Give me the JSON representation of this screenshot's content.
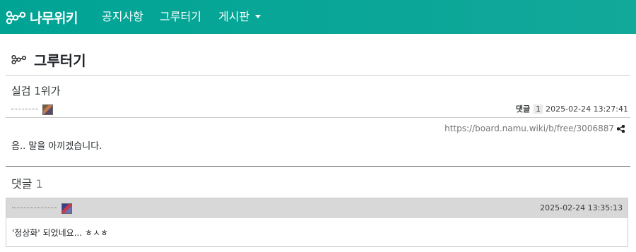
{
  "navbar": {
    "brand": "나무위키",
    "items": [
      {
        "label": "공지사항"
      },
      {
        "label": "그루터기"
      },
      {
        "label": "게시판"
      }
    ],
    "bg_color": "#00a495",
    "brand_icon": "namu-tree-logo",
    "dropdown_icon": "caret-down-icon"
  },
  "board": {
    "title": "그루터기",
    "icon": "namu-tree-icon"
  },
  "post": {
    "title": "실검 1위가",
    "comment_label": "댓글",
    "comment_count": "1",
    "datetime": "2025-02-24 13:27:41",
    "permalink": "https://board.namu.wiki/b/free/3006887",
    "body": "음.. 말을 아끼겠습니다.",
    "share_icon": "share-icon"
  },
  "comments": {
    "heading": "댓글",
    "count": "1",
    "items": [
      {
        "datetime": "2025-02-24 13:35:13",
        "body": "'정상화' 되었네요... ㅎㅅㅎ"
      }
    ]
  }
}
